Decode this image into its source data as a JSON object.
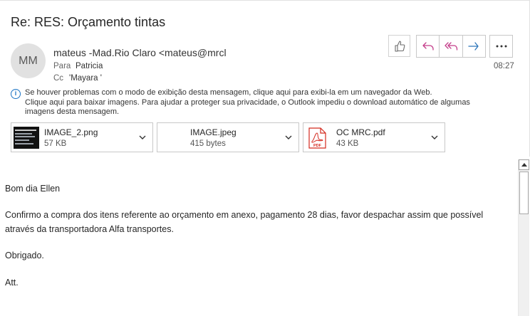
{
  "subject": "Re: RES: Orçamento tintas",
  "sender": {
    "initials": "MM",
    "display": "mateus -Mad.Rio Claro <mateus@mrcl",
    "to_label": "Para",
    "to_value": "Patricia",
    "cc_label": "Cc",
    "cc_value": "'Mayara '",
    "time": "08:27"
  },
  "actions": {
    "like": "thumbs-up-icon",
    "reply": "reply-icon",
    "reply_all": "reply-all-icon",
    "forward": "forward-icon",
    "more": "more-icon"
  },
  "info_bar": {
    "line1": "Se houver problemas com o modo de exibição desta mensagem, clique aqui para exibi-la em um navegador da Web.",
    "line2": "Clique aqui para baixar imagens. Para ajudar a proteger sua privacidade, o Outlook impediu o download automático de algumas",
    "line3": "imagens desta mensagem."
  },
  "attachments": [
    {
      "name": "IMAGE_2.png",
      "size": "57 KB",
      "type": "image-thumbnail"
    },
    {
      "name": "IMAGE.jpeg",
      "size": "415 bytes",
      "type": "image-blocked"
    },
    {
      "name": "OC MRC.pdf",
      "size": "43 KB",
      "type": "pdf-icon",
      "pdf_label": "PDF"
    }
  ],
  "body": {
    "greeting": "Bom dia Ellen",
    "line1": "Confirmo a compra dos itens referente ao orçamento em anexo, pagamento 28 dias, favor despachar assim que possível",
    "line2": "através da transportadora Alfa transportes.",
    "thanks": "Obrigado.",
    "closing": "Att."
  },
  "colors": {
    "accent": "#1a73c4",
    "reply_icon": "#c43e8a",
    "forward_icon": "#2b74b9",
    "pdf_red": "#d42a1f"
  }
}
